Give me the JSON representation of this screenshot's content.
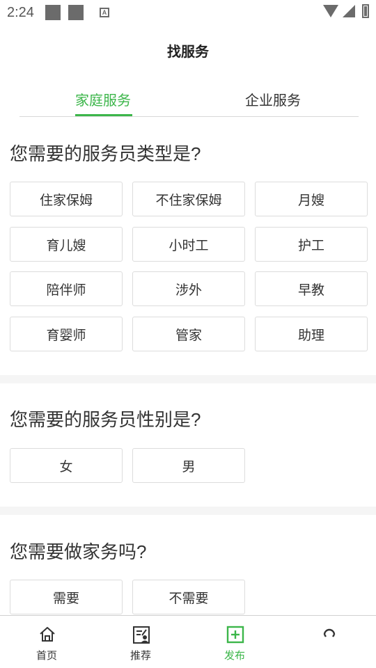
{
  "status_bar": {
    "time": "2:24",
    "a_icon": "A"
  },
  "header": {
    "title": "找服务"
  },
  "tabs": [
    {
      "label": "家庭服务",
      "active": true
    },
    {
      "label": "企业服务",
      "active": false
    }
  ],
  "sections": [
    {
      "title": "您需要的服务员类型是?",
      "options": [
        "住家保姆",
        "不住家保姆",
        "月嫂",
        "育儿嫂",
        "小时工",
        "护工",
        "陪伴师",
        "涉外",
        "早教",
        "育婴师",
        "管家",
        "助理"
      ]
    },
    {
      "title": "您需要的服务员性别是?",
      "options": [
        "女",
        "男"
      ]
    },
    {
      "title": "您需要做家务吗?",
      "options": [
        "需要",
        "不需要"
      ]
    }
  ],
  "bottom_nav": [
    {
      "label": "首页",
      "icon": "home-icon",
      "active": false
    },
    {
      "label": "推荐",
      "icon": "recommend-icon",
      "active": false
    },
    {
      "label": "发布",
      "icon": "publish-icon",
      "active": true
    },
    {
      "label": "",
      "icon": "profile-icon",
      "active": false
    }
  ],
  "colors": {
    "accent": "#3cb64a",
    "border": "#dcdcdc",
    "divider": "#f5f5f5"
  }
}
